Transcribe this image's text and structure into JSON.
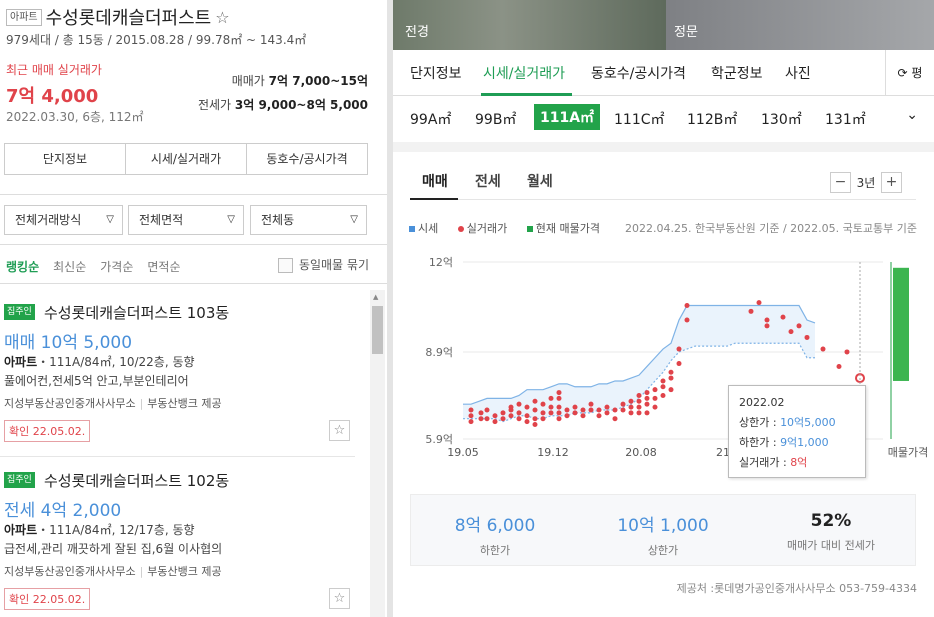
{
  "complex": {
    "type_badge": "아파트",
    "name": "수성롯데캐슬더퍼스트",
    "star": "☆",
    "subtitle": "979세대 / 총 15동 / 2015.08.28 / 99.78㎡ ~ 143.4㎡",
    "recent_label": "최근 매매 실거래가",
    "recent_price": "7억 4,000",
    "recent_date": "2022.03.30, 6층, 112㎡",
    "sale_label": "매매가",
    "sale_range": "7억 7,000~15억",
    "jeonse_label": "전세가",
    "jeonse_range": "3억 9,000~8억 5,000"
  },
  "left_buttons": [
    "단지정보",
    "시세/실거래가",
    "동호수/공시가격"
  ],
  "filters": [
    "전체거래방식",
    "전체면적",
    "전체동"
  ],
  "sort": {
    "options": [
      "랭킹순",
      "최신순",
      "가격순",
      "면적순"
    ],
    "active": 0,
    "group_label": "동일매물 묶기"
  },
  "listings": [
    {
      "tag": "집주인",
      "name": "수성롯데캐슬더퍼스트 103동",
      "price": "매매 10억 5,000",
      "type": "아파트",
      "desc": "111A/84㎡, 10/22층, 동향",
      "features": "풀에어컨,전세5억 안고,부분인테리어",
      "agent": "지성부동산공인중개사사무소",
      "provider": "부동산뱅크 제공",
      "confirmed": "확인 22.05.02."
    },
    {
      "tag": "집주인",
      "name": "수성롯데캐슬더퍼스트 102동",
      "price": "전세 4억 2,000",
      "type": "아파트",
      "desc": "111A/84㎡, 12/17층, 동향",
      "features": "급전세,관리 깨끗하게 잘된 집,6월 이사협의",
      "agent": "지성부동산공인중개사사무소",
      "provider": "부동산뱅크 제공",
      "confirmed": "확인 22.05.02."
    }
  ],
  "photos": [
    "전경",
    "정문"
  ],
  "tabs": [
    "단지정보",
    "시세/실거래가",
    "동호수/공시가격",
    "학군정보",
    "사진"
  ],
  "active_tab": 1,
  "refresh_label": "평",
  "areas": [
    "99A㎡",
    "99B㎡",
    "111A㎡",
    "111C㎡",
    "112B㎡",
    "130㎡",
    "131㎡"
  ],
  "active_area": 2,
  "chart_tabs": [
    "매매",
    "전세",
    "월세"
  ],
  "active_chart_tab": 0,
  "period": {
    "minus": "−",
    "label": "3년",
    "plus": "+"
  },
  "legend": {
    "items": [
      "시세",
      "실거래가",
      "현재 매물가격"
    ],
    "colors": [
      "#4a90d9",
      "#e0434a",
      "#22a34a"
    ]
  },
  "source_note": "2022.04.25. 한국부동산원 기준 / 2022.05. 국토교통부 기준",
  "chart_data": {
    "type": "scatter",
    "yticks": [
      "12억",
      "8.9억",
      "5.9억"
    ],
    "xticks": [
      "19.05",
      "19.12",
      "20.08",
      "21",
      "매물가격"
    ],
    "ylim": [
      5.9,
      12
    ],
    "series": [
      {
        "name": "시세",
        "type": "band",
        "points": [
          [
            0,
            6.6,
            7.1
          ],
          [
            8,
            6.6,
            7.1
          ],
          [
            16,
            6.6,
            7.2
          ],
          [
            24,
            6.6,
            7.3
          ],
          [
            32,
            6.6,
            7.3
          ],
          [
            40,
            6.5,
            7.3
          ],
          [
            48,
            6.6,
            7.3
          ],
          [
            56,
            6.7,
            7.4
          ],
          [
            64,
            6.7,
            7.6
          ],
          [
            72,
            6.6,
            7.6
          ],
          [
            80,
            6.6,
            7.6
          ],
          [
            88,
            6.7,
            7.7
          ],
          [
            96,
            6.7,
            7.8
          ],
          [
            104,
            6.7,
            7.8
          ],
          [
            112,
            6.8,
            7.7
          ],
          [
            120,
            6.8,
            7.7
          ],
          [
            128,
            6.8,
            7.7
          ],
          [
            136,
            6.9,
            7.8
          ],
          [
            144,
            6.9,
            7.8
          ],
          [
            152,
            6.9,
            7.9
          ],
          [
            160,
            7.0,
            7.9
          ],
          [
            168,
            7.1,
            8.0
          ],
          [
            176,
            7.3,
            8.1
          ],
          [
            184,
            7.6,
            8.4
          ],
          [
            192,
            7.9,
            8.7
          ],
          [
            200,
            8.2,
            9.0
          ],
          [
            208,
            8.6,
            9.2
          ],
          [
            216,
            8.9,
            10.0
          ],
          [
            224,
            9.0,
            10.5
          ],
          [
            232,
            9.1,
            10.5
          ],
          [
            240,
            9.1,
            10.5
          ],
          [
            248,
            9.1,
            10.5
          ],
          [
            256,
            9.1,
            10.5
          ],
          [
            264,
            9.1,
            10.5
          ],
          [
            272,
            9.2,
            10.5
          ],
          [
            280,
            9.2,
            10.5
          ],
          [
            288,
            9.2,
            10.5
          ],
          [
            296,
            9.2,
            10.5
          ],
          [
            304,
            9.2,
            10.5
          ],
          [
            312,
            9.2,
            10.5
          ],
          [
            320,
            9.2,
            10.5
          ],
          [
            328,
            9.2,
            10.5
          ],
          [
            336,
            9.2,
            10.5
          ],
          [
            344,
            8.7,
            10.0
          ],
          [
            352,
            8.7,
            9.9
          ]
        ]
      },
      {
        "name": "실거래가",
        "type": "scatter",
        "points": [
          [
            8,
            6.7
          ],
          [
            8,
            6.5
          ],
          [
            8,
            6.9
          ],
          [
            18,
            6.6
          ],
          [
            18,
            6.8
          ],
          [
            24,
            6.9
          ],
          [
            24,
            6.6
          ],
          [
            32,
            6.7
          ],
          [
            32,
            6.5
          ],
          [
            40,
            6.8
          ],
          [
            40,
            6.6
          ],
          [
            48,
            6.9
          ],
          [
            48,
            7.0
          ],
          [
            48,
            6.7
          ],
          [
            56,
            7.1
          ],
          [
            56,
            6.8
          ],
          [
            56,
            6.6
          ],
          [
            64,
            7.0
          ],
          [
            64,
            6.7
          ],
          [
            64,
            6.5
          ],
          [
            72,
            7.2
          ],
          [
            72,
            6.9
          ],
          [
            72,
            6.6
          ],
          [
            72,
            6.4
          ],
          [
            80,
            7.1
          ],
          [
            80,
            6.8
          ],
          [
            80,
            6.6
          ],
          [
            88,
            7.3
          ],
          [
            88,
            7.0
          ],
          [
            88,
            6.8
          ],
          [
            96,
            7.5
          ],
          [
            96,
            7.3
          ],
          [
            96,
            7.0
          ],
          [
            96,
            6.8
          ],
          [
            96,
            6.6
          ],
          [
            104,
            6.9
          ],
          [
            104,
            6.7
          ],
          [
            112,
            7.0
          ],
          [
            112,
            6.8
          ],
          [
            120,
            6.9
          ],
          [
            120,
            6.7
          ],
          [
            128,
            7.1
          ],
          [
            128,
            6.9
          ],
          [
            136,
            6.9
          ],
          [
            136,
            6.7
          ],
          [
            144,
            7.0
          ],
          [
            144,
            6.8
          ],
          [
            152,
            6.9
          ],
          [
            152,
            6.6
          ],
          [
            160,
            7.1
          ],
          [
            160,
            6.9
          ],
          [
            168,
            7.2
          ],
          [
            168,
            7.0
          ],
          [
            168,
            6.8
          ],
          [
            176,
            7.4
          ],
          [
            176,
            7.2
          ],
          [
            176,
            7.0
          ],
          [
            176,
            6.8
          ],
          [
            184,
            7.5
          ],
          [
            184,
            7.3
          ],
          [
            184,
            7.1
          ],
          [
            184,
            6.8
          ],
          [
            192,
            7.6
          ],
          [
            192,
            7.3
          ],
          [
            192,
            7.0
          ],
          [
            200,
            7.9
          ],
          [
            200,
            7.7
          ],
          [
            200,
            7.4
          ],
          [
            208,
            8.2
          ],
          [
            208,
            8.0
          ],
          [
            208,
            7.6
          ],
          [
            216,
            9.0
          ],
          [
            216,
            8.5
          ],
          [
            224,
            10.5
          ],
          [
            224,
            10.0
          ],
          [
            288,
            10.3
          ],
          [
            296,
            10.6
          ],
          [
            304,
            9.8
          ],
          [
            304,
            10.0
          ],
          [
            320,
            10.1
          ],
          [
            328,
            9.6
          ],
          [
            336,
            9.8
          ],
          [
            344,
            9.4
          ],
          [
            360,
            9.0
          ],
          [
            376,
            8.4
          ],
          [
            384,
            8.9
          ]
        ]
      },
      {
        "name": "현재 매물가격",
        "type": "range",
        "points": [
          [
            465,
            7.9,
            11.8
          ]
        ]
      }
    ]
  },
  "tooltip": {
    "date": "2022.02",
    "high_label": "상한가 : ",
    "high": "10억5,000",
    "low_label": "하한가 : ",
    "low": "9억1,000",
    "deal_label": "실거래가 : ",
    "deal": "8억"
  },
  "summary": [
    {
      "value": "8억 6,000",
      "label": "하한가"
    },
    {
      "value": "10억 1,000",
      "label": "상한가"
    },
    {
      "value": "52%",
      "label": "매매가 대비 전세가"
    }
  ],
  "supplier": "제공처 :롯데명가공인중개사사무소 053-759-4334"
}
